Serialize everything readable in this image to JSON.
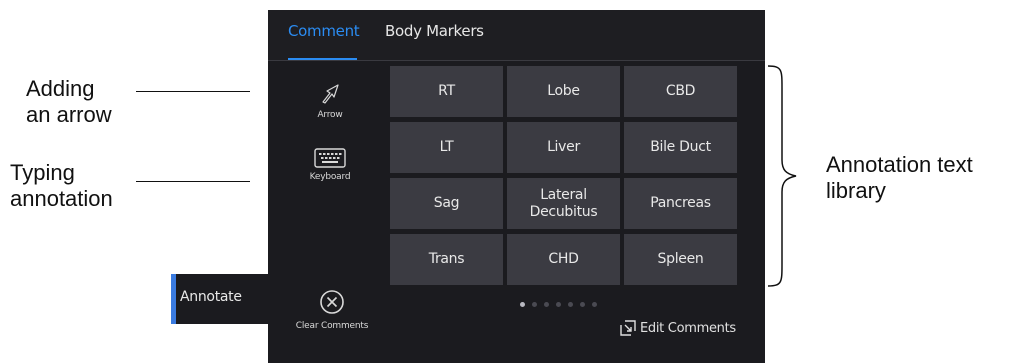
{
  "callouts": {
    "arrow_line1": "Adding",
    "arrow_line2": "an arrow",
    "typing_line1": "Typing",
    "typing_line2": "annotation",
    "library_line1": "Annotation text",
    "library_line2": "library"
  },
  "tabs": [
    {
      "label": "Comment",
      "active": true
    },
    {
      "label": "Body Markers",
      "active": false
    }
  ],
  "tools": {
    "arrow": {
      "label": "Arrow",
      "icon": "arrow-icon"
    },
    "keyboard": {
      "label": "Keyboard",
      "icon": "keyboard-icon"
    },
    "clear": {
      "label": "Clear Comments",
      "icon": "close-circle-icon"
    }
  },
  "library": {
    "rows": [
      [
        "RT",
        "Lobe",
        "CBD"
      ],
      [
        "LT",
        "Liver",
        "Bile Duct"
      ],
      [
        "Sag",
        "Lateral Decubitus",
        "Pancreas"
      ],
      [
        "Trans",
        "CHD",
        "Spleen"
      ]
    ]
  },
  "pager": {
    "pages": 7,
    "current": 1
  },
  "edit_comments": {
    "label": "Edit Comments",
    "icon": "edit-comments-icon"
  },
  "annotate_tab": {
    "label": "Annotate"
  },
  "colors": {
    "accent": "#2b8cf2",
    "panel": "#1b1b1f",
    "cell": "#3b3b42"
  }
}
